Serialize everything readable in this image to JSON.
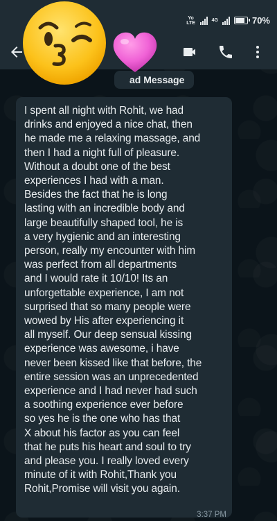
{
  "status_bar": {
    "network_a": "Yo LTE",
    "network_b": "4G",
    "battery": "70%"
  },
  "header": {
    "back_icon": "back-arrow-icon",
    "video_icon": "video-call-icon",
    "call_icon": "phone-icon",
    "menu_icon": "more-vert-icon"
  },
  "overlay": {
    "emoji_1": "kissing-face-emoji",
    "emoji_2": "pink-heart-emoji"
  },
  "pill": {
    "label": "ad Message"
  },
  "message": {
    "lines": [
      "I spent all night with Rohit, we had",
      "drinks and enjoyed a nice chat, then",
      "he made me a relaxing massage, and",
      "then I had a night full of pleasure.",
      "Without a doubt one of the best",
      "experiences I had with a man.",
      "Besides the fact that he is long",
      "lasting with an incredible body and",
      "large beautifully shaped tool, he is",
      "a very hygienic and an interesting",
      "person, really my encounter with him",
      "was perfect from all departments",
      "and I would rate it 10/10! Its an",
      "unforgettable experience, I am not",
      "surprised that so many people were",
      "wowed by His after experiencing it",
      "all myself. Our deep sensual kissing",
      "experience was awesome, i have",
      "never been kissed like that before, the",
      "entire session was an unprecedented",
      "experience and I had never had such",
      "a soothing experience ever before",
      "so yes he is the one who has that",
      "X about his factor as you can feel",
      "that he puts his heart and soul to try",
      "and please you. I really loved every",
      "minute of it with Rohit,Thank you",
      "Rohit,Promise will visit you again."
    ],
    "time": "3:37 PM"
  },
  "colors": {
    "background": "#0b141a",
    "bar": "#1f2c34",
    "bubble": "#1f2c34",
    "text": "#e9edef",
    "meta": "#8696a0"
  }
}
